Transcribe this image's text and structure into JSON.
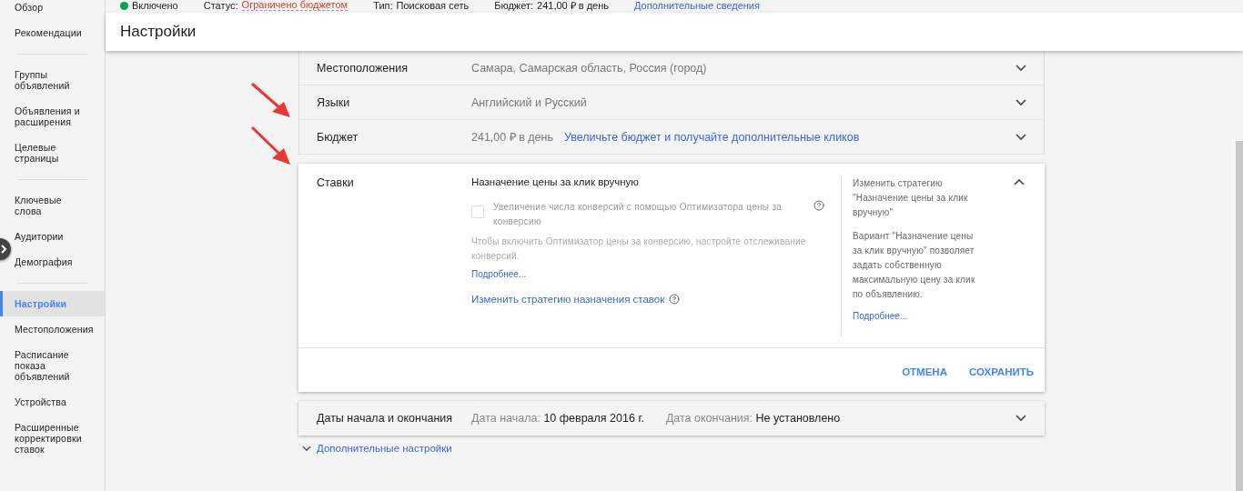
{
  "summary": {
    "enabled_label": "Включено",
    "items": [
      {
        "kind": "status",
        "label": "Статус:",
        "value": "Ограничено бюджетом"
      },
      {
        "kind": "plain",
        "label": "Тип:",
        "value": "Поисковая сеть"
      },
      {
        "kind": "plain",
        "label": "Бюджет:",
        "value": "241,00 ₽ в день"
      }
    ],
    "details_link": "Дополнительные сведения"
  },
  "sidebar": {
    "groups": [
      [
        {
          "label": "Обзор",
          "selected": false
        },
        {
          "label": "Рекомендации",
          "selected": false
        }
      ],
      [
        {
          "label": "Группы объявлений",
          "selected": false
        },
        {
          "label": "Объявления и расширения",
          "selected": false
        },
        {
          "label": "Целевые страницы",
          "selected": false
        }
      ],
      [
        {
          "label": "Ключевые слова",
          "selected": false
        },
        {
          "label": "Аудитории",
          "selected": false
        },
        {
          "label": "Демография",
          "selected": false
        }
      ],
      [
        {
          "label": "Настройки",
          "selected": true
        },
        {
          "label": "Местоположения",
          "selected": false
        },
        {
          "label": "Расписание показа объявлений",
          "selected": false
        },
        {
          "label": "Устройства",
          "selected": false
        },
        {
          "label": "Расширенные корректировки ставок",
          "selected": false
        }
      ]
    ]
  },
  "header": {
    "title": "Настройки"
  },
  "rows": [
    {
      "label": "Местоположения",
      "value": "Самара, Самарская область, Россия (город)",
      "expanded": false
    },
    {
      "label": "Языки",
      "value": "Английский и Русский",
      "expanded": false
    },
    {
      "label": "Бюджет",
      "value": "241,00 ₽ в день",
      "link": "Увеличьте бюджет и получайте дополнительные кликов",
      "expanded": false
    }
  ],
  "bids": {
    "label": "Ставки",
    "expanded": true,
    "strategy": "Назначение цены за клик вручную",
    "checkbox": {
      "label": "Увеличение числа конверсий с помощью Оптимизатора цены за конверсию",
      "checked": false,
      "disabled": true
    },
    "hint": "Чтобы включить Оптимизатор цены за конверсию, настройте отслеживание конверсий.",
    "hint_link": "Подробнее...",
    "change_link": "Изменить стратегию назначения ставок",
    "side_title": "Изменить стратегию \"Назначение цены за клик вручную\"",
    "side_text": "Вариант \"Назначение цены за клик вручную\" позволяет задать собственную максимальную цену за клик по объявлению.",
    "side_link": "Подробнее...",
    "buttons": [
      "ОТМЕНА",
      "СОХРАНИТЬ"
    ]
  },
  "dates": {
    "label": "Даты начала и окончания",
    "expanded": false,
    "parts": [
      {
        "label": "Дата начала:",
        "value": "10 февраля 2016 г."
      },
      {
        "label": "Дата окончания:",
        "value": "Не установлено"
      }
    ]
  },
  "more_settings": {
    "label": "Дополнительные настройки",
    "expanded": false
  }
}
